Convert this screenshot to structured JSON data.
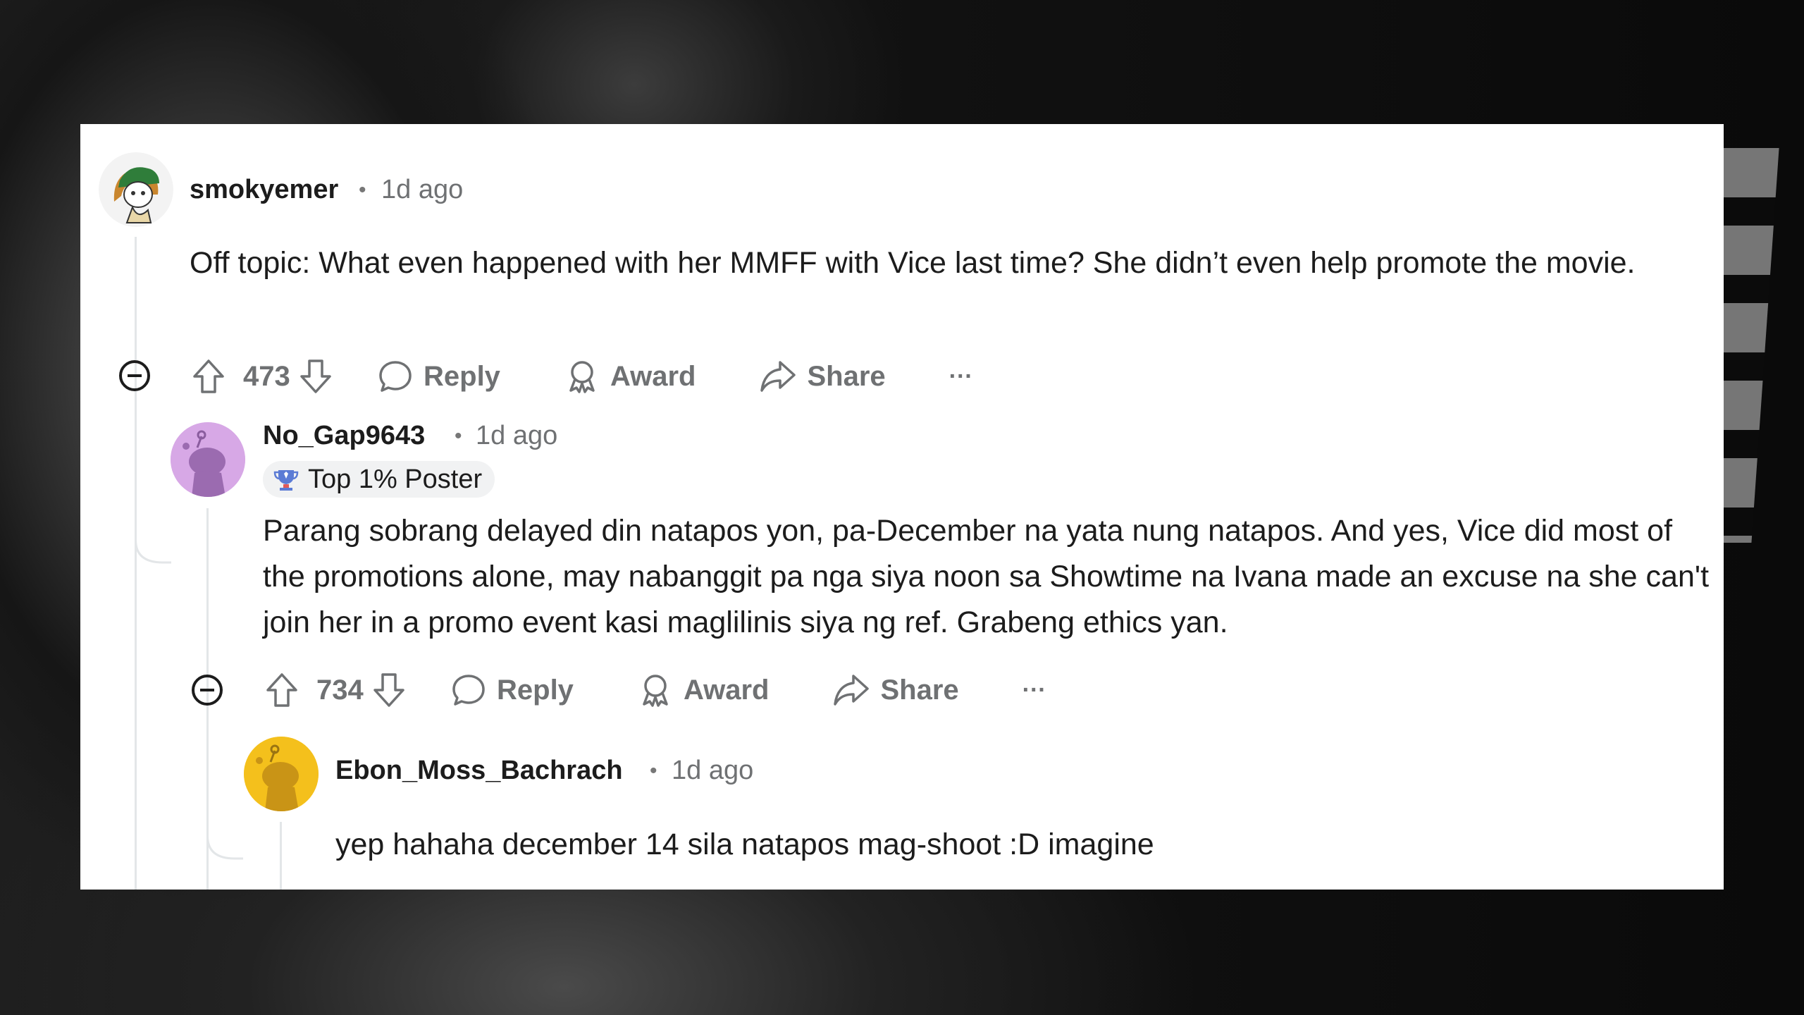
{
  "comments": [
    {
      "username": "smokyemer",
      "time": "1d ago",
      "text": "Off topic: What even happened with her MMFF with Vice last time? She didn’t even help promote the movie.",
      "votes": "473",
      "reply_label": "Reply",
      "award_label": "Award",
      "share_label": "Share",
      "more_label": "···"
    },
    {
      "username": "No_Gap9643",
      "time": "1d ago",
      "flair": "Top 1% Poster",
      "text": "Parang sobrang delayed din natapos yon, pa-December na yata nung natapos. And yes, Vice did most of the promotions alone, may nabanggit pa nga siya noon sa Showtime na Ivana made an excuse na she can't join her in a promo event kasi maglilinis siya ng ref. Grabeng ethics yan.",
      "votes": "734",
      "reply_label": "Reply",
      "award_label": "Award",
      "share_label": "Share",
      "more_label": "···"
    },
    {
      "username": "Ebon_Moss_Bachrach",
      "time": "1d ago",
      "text": "yep hahaha december 14 sila natapos mag-shoot :D imagine"
    }
  ],
  "separator": "•",
  "icons": {
    "collapse": "minus-circle-icon",
    "upvote": "arrow-up-icon",
    "downvote": "arrow-down-icon",
    "reply": "speech-bubble-icon",
    "award": "award-ribbon-icon",
    "share": "share-arrow-icon",
    "flair": "trophy-icon"
  },
  "colors": {
    "text": "#1c1c1c",
    "meta": "#6f7173",
    "thread_line": "#e3e6e8",
    "avatar_2": "#d7a8e6",
    "avatar_3": "#f4c01c"
  }
}
